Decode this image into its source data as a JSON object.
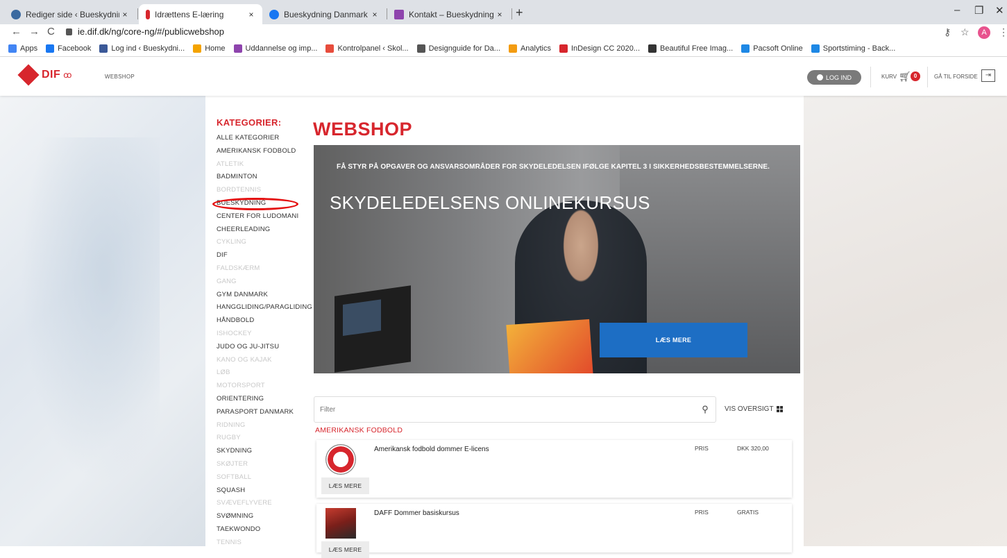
{
  "browser": {
    "tabs": [
      {
        "label": "Rediger side ‹ Bueskydning Dan",
        "active": false
      },
      {
        "label": "Idrættens E-læring",
        "active": true
      },
      {
        "label": "Bueskydning Danmark | Facebo",
        "active": false
      },
      {
        "label": "Kontakt – Bueskydning Danmark",
        "active": false
      }
    ],
    "close_glyph": "×",
    "new_tab": "+",
    "url": "ie.dif.dk/ng/core-ng/#/publicwebshop",
    "profile_initial": "A",
    "bookmarks": [
      "Apps",
      "Facebook",
      "Log ind ‹ Bueskydni...",
      "Home",
      "Uddannelse og imp...",
      "Kontrolpanel ‹ Skol...",
      "Designguide for Da...",
      "Analytics",
      "InDesign CC 2020...",
      "Beautiful Free Imag...",
      "Pacsoft Online",
      "Sportstiming - Back..."
    ],
    "bookmark_colors": [
      "#4285f4",
      "#1877f2",
      "#3b5998",
      "#f4a300",
      "#8e44ad",
      "#e74c3c",
      "#555555",
      "#f39c12",
      "#d7262d",
      "#333333",
      "#1e88e5",
      "#1e88e5"
    ]
  },
  "header": {
    "logo_text": "DIF",
    "nav_label": "WEBSHOP",
    "login_label": "LOG IND",
    "cart_label": "KURV",
    "cart_count": "0",
    "goto_label": "GÅ TIL FORSIDE"
  },
  "sidebar": {
    "title": "KATEGORIER:",
    "items": [
      {
        "label": "ALLE KATEGORIER",
        "active": true
      },
      {
        "label": "AMERIKANSK FODBOLD",
        "active": true
      },
      {
        "label": "ATLETIK",
        "active": false
      },
      {
        "label": "BADMINTON",
        "active": true
      },
      {
        "label": "BORDTENNIS",
        "active": false
      },
      {
        "label": "BUESKYDNING",
        "active": true,
        "highlighted": true
      },
      {
        "label": "CENTER FOR LUDOMANI",
        "active": true
      },
      {
        "label": "CHEERLEADING",
        "active": true
      },
      {
        "label": "CYKLING",
        "active": false
      },
      {
        "label": "DIF",
        "active": true
      },
      {
        "label": "FALDSKÆRM",
        "active": false
      },
      {
        "label": "GANG",
        "active": false
      },
      {
        "label": "GYM DANMARK",
        "active": true
      },
      {
        "label": "HANGGLIDING/PARAGLIDING",
        "active": true
      },
      {
        "label": "HÅNDBOLD",
        "active": true
      },
      {
        "label": "ISHOCKEY",
        "active": false
      },
      {
        "label": "JUDO OG JU-JITSU",
        "active": true
      },
      {
        "label": "KANO OG KAJAK",
        "active": false
      },
      {
        "label": "LØB",
        "active": false
      },
      {
        "label": "MOTORSPORT",
        "active": false
      },
      {
        "label": "ORIENTERING",
        "active": true
      },
      {
        "label": "PARASPORT DANMARK",
        "active": true
      },
      {
        "label": "RIDNING",
        "active": false
      },
      {
        "label": "RUGBY",
        "active": false
      },
      {
        "label": "SKYDNING",
        "active": true
      },
      {
        "label": "SKØJTER",
        "active": false
      },
      {
        "label": "SOFTBALL",
        "active": false
      },
      {
        "label": "SQUASH",
        "active": true
      },
      {
        "label": "SVÆVEFLYVERE",
        "active": false
      },
      {
        "label": "SVØMNING",
        "active": true
      },
      {
        "label": "TAEKWONDO",
        "active": true
      },
      {
        "label": "TENNIS",
        "active": false
      }
    ]
  },
  "main": {
    "title": "WEBSHOP",
    "hero": {
      "subtitle": "FÅ STYR PÅ OPGAVER OG ANSVARSOMRÅDER FOR SKYDELEDELSEN IFØLGE KAPITEL 3 I SIKKERHEDSBESTEMMELSERNE.",
      "title": "SKYDELEDELSENS ONLINEKURSUS",
      "button": "LÆS MERE"
    },
    "filter_placeholder": "Filter",
    "overview_label": "VIS OVERSIGT",
    "section_title": "AMERIKANSK FODBOLD",
    "products": [
      {
        "name": "Amerikansk fodbold dommer E-licens",
        "price_label": "PRIS",
        "price": "DKK 320,00",
        "button": "LÆS MERE"
      },
      {
        "name": "DAFF Dommer basiskursus",
        "price_label": "PRIS",
        "price": "GRATIS",
        "button": "LÆS MERE"
      }
    ]
  },
  "colors": {
    "brand_red": "#d7262d",
    "hero_button": "#1d6ec4",
    "highlight_oval": "#e41010"
  }
}
